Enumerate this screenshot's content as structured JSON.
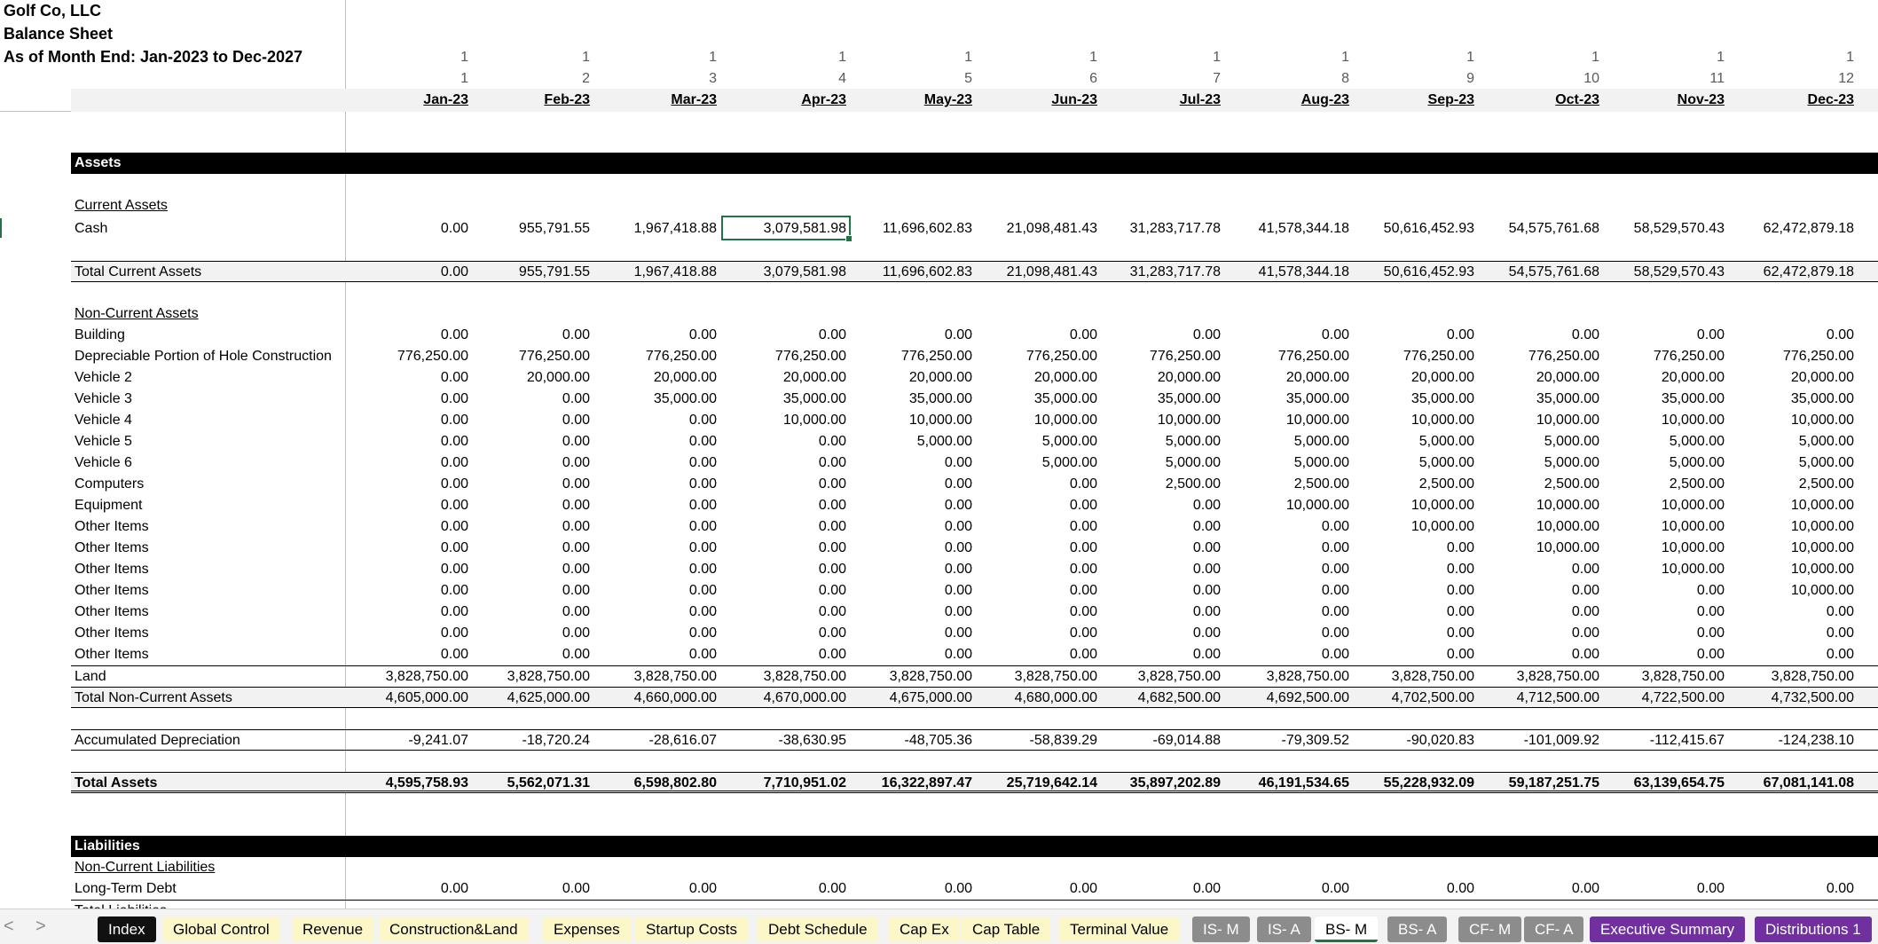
{
  "title": {
    "company": "Golf Co, LLC",
    "report": "Balance Sheet",
    "period": "As of Month End: Jan-2023 to Dec-2027"
  },
  "header": {
    "years": [
      "1",
      "1",
      "1",
      "1",
      "1",
      "1",
      "1",
      "1",
      "1",
      "1",
      "1",
      "1"
    ],
    "periods": [
      "1",
      "2",
      "3",
      "4",
      "5",
      "6",
      "7",
      "8",
      "9",
      "10",
      "11",
      "12"
    ],
    "months": [
      "Jan-23",
      "Feb-23",
      "Mar-23",
      "Apr-23",
      "May-23",
      "Jun-23",
      "Jul-23",
      "Aug-23",
      "Sep-23",
      "Oct-23",
      "Nov-23",
      "Dec-23"
    ]
  },
  "rows": [
    {
      "label": "Assets"
    },
    {
      "label": "Current Assets"
    },
    {
      "label": "Cash",
      "values": [
        "0.00",
        "955,791.55",
        "1,967,418.88",
        "3,079,581.98",
        "11,696,602.83",
        "21,098,481.43",
        "31,283,717.78",
        "41,578,344.18",
        "50,616,452.93",
        "54,575,761.68",
        "58,529,570.43",
        "62,472,879.18"
      ]
    },
    {
      "label": "Total Current Assets",
      "values": [
        "0.00",
        "955,791.55",
        "1,967,418.88",
        "3,079,581.98",
        "11,696,602.83",
        "21,098,481.43",
        "31,283,717.78",
        "41,578,344.18",
        "50,616,452.93",
        "54,575,761.68",
        "58,529,570.43",
        "62,472,879.18"
      ]
    },
    {
      "label": "Non-Current Assets"
    },
    {
      "label": "Building",
      "values": [
        "0.00",
        "0.00",
        "0.00",
        "0.00",
        "0.00",
        "0.00",
        "0.00",
        "0.00",
        "0.00",
        "0.00",
        "0.00",
        "0.00"
      ]
    },
    {
      "label": "Depreciable Portion of Hole Construction",
      "values": [
        "776,250.00",
        "776,250.00",
        "776,250.00",
        "776,250.00",
        "776,250.00",
        "776,250.00",
        "776,250.00",
        "776,250.00",
        "776,250.00",
        "776,250.00",
        "776,250.00",
        "776,250.00"
      ]
    },
    {
      "label": "Vehicle 2",
      "values": [
        "0.00",
        "20,000.00",
        "20,000.00",
        "20,000.00",
        "20,000.00",
        "20,000.00",
        "20,000.00",
        "20,000.00",
        "20,000.00",
        "20,000.00",
        "20,000.00",
        "20,000.00"
      ]
    },
    {
      "label": "Vehicle 3",
      "values": [
        "0.00",
        "0.00",
        "35,000.00",
        "35,000.00",
        "35,000.00",
        "35,000.00",
        "35,000.00",
        "35,000.00",
        "35,000.00",
        "35,000.00",
        "35,000.00",
        "35,000.00"
      ]
    },
    {
      "label": "Vehicle 4",
      "values": [
        "0.00",
        "0.00",
        "0.00",
        "10,000.00",
        "10,000.00",
        "10,000.00",
        "10,000.00",
        "10,000.00",
        "10,000.00",
        "10,000.00",
        "10,000.00",
        "10,000.00"
      ]
    },
    {
      "label": "Vehicle 5",
      "values": [
        "0.00",
        "0.00",
        "0.00",
        "0.00",
        "5,000.00",
        "5,000.00",
        "5,000.00",
        "5,000.00",
        "5,000.00",
        "5,000.00",
        "5,000.00",
        "5,000.00"
      ]
    },
    {
      "label": "Vehicle 6",
      "values": [
        "0.00",
        "0.00",
        "0.00",
        "0.00",
        "0.00",
        "5,000.00",
        "5,000.00",
        "5,000.00",
        "5,000.00",
        "5,000.00",
        "5,000.00",
        "5,000.00"
      ]
    },
    {
      "label": "Computers",
      "values": [
        "0.00",
        "0.00",
        "0.00",
        "0.00",
        "0.00",
        "0.00",
        "2,500.00",
        "2,500.00",
        "2,500.00",
        "2,500.00",
        "2,500.00",
        "2,500.00"
      ]
    },
    {
      "label": "Equipment",
      "values": [
        "0.00",
        "0.00",
        "0.00",
        "0.00",
        "0.00",
        "0.00",
        "0.00",
        "10,000.00",
        "10,000.00",
        "10,000.00",
        "10,000.00",
        "10,000.00"
      ]
    },
    {
      "label": "Other Items",
      "values": [
        "0.00",
        "0.00",
        "0.00",
        "0.00",
        "0.00",
        "0.00",
        "0.00",
        "0.00",
        "10,000.00",
        "10,000.00",
        "10,000.00",
        "10,000.00"
      ]
    },
    {
      "label": "Other Items",
      "values": [
        "0.00",
        "0.00",
        "0.00",
        "0.00",
        "0.00",
        "0.00",
        "0.00",
        "0.00",
        "0.00",
        "10,000.00",
        "10,000.00",
        "10,000.00"
      ]
    },
    {
      "label": "Other Items",
      "values": [
        "0.00",
        "0.00",
        "0.00",
        "0.00",
        "0.00",
        "0.00",
        "0.00",
        "0.00",
        "0.00",
        "0.00",
        "10,000.00",
        "10,000.00"
      ]
    },
    {
      "label": "Other Items",
      "values": [
        "0.00",
        "0.00",
        "0.00",
        "0.00",
        "0.00",
        "0.00",
        "0.00",
        "0.00",
        "0.00",
        "0.00",
        "0.00",
        "10,000.00"
      ]
    },
    {
      "label": "Other Items",
      "values": [
        "0.00",
        "0.00",
        "0.00",
        "0.00",
        "0.00",
        "0.00",
        "0.00",
        "0.00",
        "0.00",
        "0.00",
        "0.00",
        "0.00"
      ]
    },
    {
      "label": "Other Items",
      "values": [
        "0.00",
        "0.00",
        "0.00",
        "0.00",
        "0.00",
        "0.00",
        "0.00",
        "0.00",
        "0.00",
        "0.00",
        "0.00",
        "0.00"
      ]
    },
    {
      "label": "Other Items",
      "values": [
        "0.00",
        "0.00",
        "0.00",
        "0.00",
        "0.00",
        "0.00",
        "0.00",
        "0.00",
        "0.00",
        "0.00",
        "0.00",
        "0.00"
      ]
    },
    {
      "label": "Land",
      "values": [
        "3,828,750.00",
        "3,828,750.00",
        "3,828,750.00",
        "3,828,750.00",
        "3,828,750.00",
        "3,828,750.00",
        "3,828,750.00",
        "3,828,750.00",
        "3,828,750.00",
        "3,828,750.00",
        "3,828,750.00",
        "3,828,750.00"
      ]
    },
    {
      "label": "Total Non-Current Assets",
      "values": [
        "4,605,000.00",
        "4,625,000.00",
        "4,660,000.00",
        "4,670,000.00",
        "4,675,000.00",
        "4,680,000.00",
        "4,682,500.00",
        "4,692,500.00",
        "4,702,500.00",
        "4,712,500.00",
        "4,722,500.00",
        "4,732,500.00"
      ]
    },
    {
      "label": "Accumulated Depreciation",
      "values": [
        "-9,241.07",
        "-18,720.24",
        "-28,616.07",
        "-38,630.95",
        "-48,705.36",
        "-58,839.29",
        "-69,014.88",
        "-79,309.52",
        "-90,020.83",
        "-101,009.92",
        "-112,415.67",
        "-124,238.10"
      ]
    },
    {
      "label": "Total Assets",
      "values": [
        "4,595,758.93",
        "5,562,071.31",
        "6,598,802.80",
        "7,710,951.02",
        "16,322,897.47",
        "25,719,642.14",
        "35,897,202.89",
        "46,191,534.65",
        "55,228,932.09",
        "59,187,251.75",
        "63,139,654.75",
        "67,081,141.08"
      ]
    },
    {
      "label": "Liabilities"
    },
    {
      "label": "Non-Current Liabilities"
    },
    {
      "label": "Long-Term Debt",
      "values": [
        "0.00",
        "0.00",
        "0.00",
        "0.00",
        "0.00",
        "0.00",
        "0.00",
        "0.00",
        "0.00",
        "0.00",
        "0.00",
        "0.00"
      ]
    },
    {
      "label": "Total Liabilities"
    }
  ],
  "tabs": [
    "Index",
    "Global Control",
    "Revenue",
    "Construction&Land",
    "Expenses",
    "Startup Costs",
    "Debt Schedule",
    "Cap Ex",
    "Cap Table",
    "Terminal Value",
    "IS- M",
    "IS- A",
    "BS- M",
    "BS- A",
    "CF- M",
    "CF- A",
    "Executive Summary",
    "Distributions 1"
  ],
  "nav": {
    "prev": "<",
    "next": ">"
  }
}
